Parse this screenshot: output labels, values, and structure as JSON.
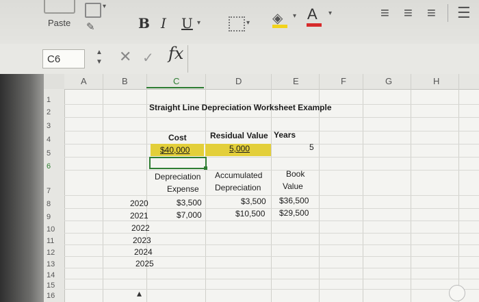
{
  "ribbon": {
    "paste_label": "Paste",
    "bold_label": "B",
    "italic_label": "I",
    "underline_label": "U",
    "font_color_label": "A",
    "fill_color": "#f2d31b",
    "font_color": "#d62b2b"
  },
  "formula_bar": {
    "name_box": "C6",
    "fx_label": "fx",
    "formula": ""
  },
  "columns": [
    "A",
    "B",
    "C",
    "D",
    "E",
    "F",
    "G",
    "H"
  ],
  "active_column": "C",
  "rows": [
    "1",
    "2",
    "3",
    "4",
    "5",
    "6",
    "7",
    "8",
    "9",
    "10",
    "11",
    "12",
    "13",
    "14",
    "15",
    "16"
  ],
  "active_row": "6",
  "sheet": {
    "title": "Straight Line Depreciation Worksheet Example",
    "headers": {
      "cost": "Cost",
      "residual": "Residual Value",
      "years": "Years"
    },
    "values": {
      "cost": "$40,000",
      "residual": "5,000",
      "years": "5"
    },
    "table_headers": {
      "depr_1": "Depreciation",
      "depr_2": "Expense",
      "acc_1": "Accumulated",
      "acc_2": "Depreciation",
      "book_1": "Book",
      "book_2": "Value"
    },
    "years": [
      "2020",
      "2021",
      "2022",
      "2023",
      "2024",
      "2025"
    ],
    "expense": [
      "$3,500",
      "$7,000"
    ],
    "accumulated": [
      "$3,500",
      "$10,500"
    ],
    "book_value": [
      "$36,500",
      "$29,500"
    ]
  },
  "highlight_color": "#e3cf3a",
  "selection_color": "#2e7d32"
}
